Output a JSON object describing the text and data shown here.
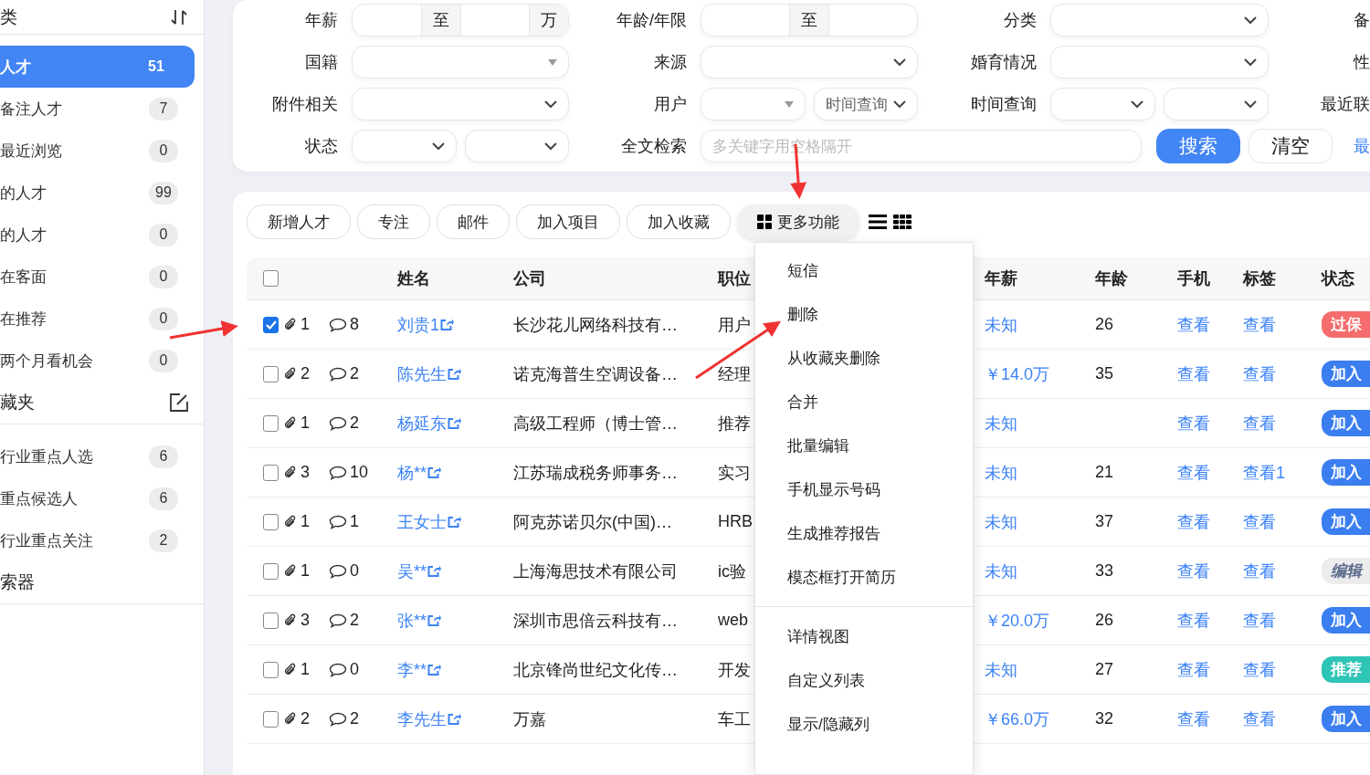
{
  "sidebar": {
    "header": "类",
    "items": [
      {
        "label": "人才",
        "count": "51",
        "selected": true
      },
      {
        "label": "备注人才",
        "count": "7",
        "selected": false
      },
      {
        "label": "最近浏览",
        "count": "0",
        "selected": false
      },
      {
        "label": "的人才",
        "count": "99",
        "selected": false
      },
      {
        "label": "的人才",
        "count": "0",
        "selected": false
      },
      {
        "label": "在客面",
        "count": "0",
        "selected": false
      },
      {
        "label": "在推荐",
        "count": "0",
        "selected": false
      },
      {
        "label": "两个月看机会",
        "count": "0",
        "selected": false
      }
    ],
    "folders_header": "藏夹",
    "folders": [
      {
        "label": "行业重点人选",
        "count": "6",
        "selected": false
      },
      {
        "label": "重点候选人",
        "count": "6",
        "selected": false
      },
      {
        "label": "行业重点关注",
        "count": "2",
        "selected": false
      }
    ],
    "footer": "索器"
  },
  "filters": [
    [
      {
        "label": "年薪",
        "controls": [
          {
            "kind": "range",
            "separator": "至",
            "unit": "万"
          }
        ]
      },
      {
        "label": "年龄/年限",
        "controls": [
          {
            "kind": "range",
            "separator": "至"
          }
        ]
      },
      {
        "label": "分类",
        "controls": [
          {
            "kind": "select"
          }
        ]
      },
      {
        "label": "备"
      }
    ],
    [
      {
        "label": "国籍",
        "controls": [
          {
            "kind": "dropdown"
          }
        ]
      },
      {
        "label": "来源",
        "controls": [
          {
            "kind": "select"
          }
        ]
      },
      {
        "label": "婚育情况",
        "controls": [
          {
            "kind": "select"
          }
        ]
      },
      {
        "label": "性"
      }
    ],
    [
      {
        "label": "附件相关",
        "controls": [
          {
            "kind": "select"
          }
        ]
      },
      {
        "label": "用户",
        "controls": [
          {
            "kind": "dropdown"
          },
          {
            "kind": "select",
            "value": "时间查询"
          }
        ]
      },
      {
        "label": "时间查询",
        "controls": [
          {
            "kind": "select"
          },
          {
            "kind": "select"
          }
        ]
      },
      {
        "label": "最近联"
      }
    ],
    [
      {
        "label": "状态",
        "controls": [
          {
            "kind": "select"
          },
          {
            "kind": "select"
          }
        ]
      },
      {
        "label": "全文检索",
        "controls": [
          {
            "kind": "text",
            "placeholder": "多关键字用空格隔开"
          },
          {
            "kind": "button",
            "label": "搜索",
            "primary": true
          },
          {
            "kind": "button",
            "label": "清空",
            "primary": false
          },
          {
            "kind": "link",
            "label": "最"
          }
        ]
      }
    ]
  ],
  "toolbar": {
    "buttons": [
      "新增人才",
      "专注",
      "邮件",
      "加入项目",
      "加入收藏"
    ],
    "more": "更多功能"
  },
  "more_menu": [
    [
      "短信",
      "删除",
      "从收藏夹删除",
      "合并",
      "批量编辑",
      "手机显示号码",
      "生成推荐报告",
      "模态框打开简历"
    ],
    [
      "详情视图",
      "自定义列表",
      "显示/隐藏列"
    ]
  ],
  "table": {
    "all_checked": false,
    "columns": [
      "姓名",
      "公司",
      "职位",
      "年薪",
      "年龄",
      "手机",
      "标签",
      "状态"
    ],
    "rows": [
      {
        "checked": true,
        "attachments": "1",
        "comments": "8",
        "name": "刘贵1",
        "company": "长沙花儿网络科技有…",
        "position": "用户",
        "salary": "未知",
        "age": "26",
        "phone": "查看",
        "tags": "查看",
        "status": {
          "label": "过保",
          "kind": "danger"
        }
      },
      {
        "checked": false,
        "attachments": "2",
        "comments": "2",
        "name": "陈先生",
        "company": "诺克海普生空调设备…",
        "position": "经理",
        "salary": "￥14.0万",
        "age": "35",
        "phone": "查看",
        "tags": "查看",
        "status": {
          "label": "加入",
          "kind": "primary"
        }
      },
      {
        "checked": false,
        "attachments": "1",
        "comments": "2",
        "name": "杨延东",
        "company": "高级工程师（博士管…",
        "position": "推荐",
        "salary": "未知",
        "phone": "查看",
        "tags": "查看",
        "status": {
          "label": "加入",
          "kind": "primary"
        }
      },
      {
        "checked": false,
        "attachments": "3",
        "comments": "10",
        "name": "杨**",
        "company": "江苏瑞成税务师事务…",
        "position": "实习",
        "salary": "未知",
        "age": "21",
        "phone": "查看",
        "tags": "查看1",
        "status": {
          "label": "加入",
          "kind": "primary"
        }
      },
      {
        "checked": false,
        "attachments": "1",
        "comments": "1",
        "name": "王女士",
        "company": "阿克苏诺贝尔(中国)…",
        "position": "HRB",
        "salary": "未知",
        "age": "37",
        "phone": "查看",
        "tags": "查看",
        "status": {
          "label": "加入",
          "kind": "primary"
        }
      },
      {
        "checked": false,
        "attachments": "1",
        "comments": "0",
        "name": "吴**",
        "company": "上海海思技术有限公司",
        "position": "ic验",
        "salary": "未知",
        "age": "33",
        "phone": "查看",
        "tags": "查看",
        "status": {
          "label": "编辑",
          "kind": "muted"
        }
      },
      {
        "checked": false,
        "attachments": "3",
        "comments": "2",
        "name": "张**",
        "company": "深圳市思倍云科技有…",
        "position": "web",
        "salary": "￥20.0万",
        "age": "26",
        "phone": "查看",
        "tags": "查看",
        "status": {
          "label": "加入",
          "kind": "primary"
        }
      },
      {
        "checked": false,
        "attachments": "1",
        "comments": "0",
        "name": "李**",
        "company": "北京锋尚世纪文化传…",
        "position": "开发",
        "salary": "未知",
        "age": "27",
        "phone": "查看",
        "tags": "查看",
        "status": {
          "label": "推荐",
          "kind": "success"
        }
      },
      {
        "checked": false,
        "attachments": "2",
        "comments": "2",
        "name": "李先生",
        "company": "万嘉",
        "position": "车工",
        "salary": "￥66.0万",
        "age": "32",
        "phone": "查看",
        "tags": "查看",
        "status": {
          "label": "加入",
          "kind": "primary"
        }
      }
    ]
  }
}
